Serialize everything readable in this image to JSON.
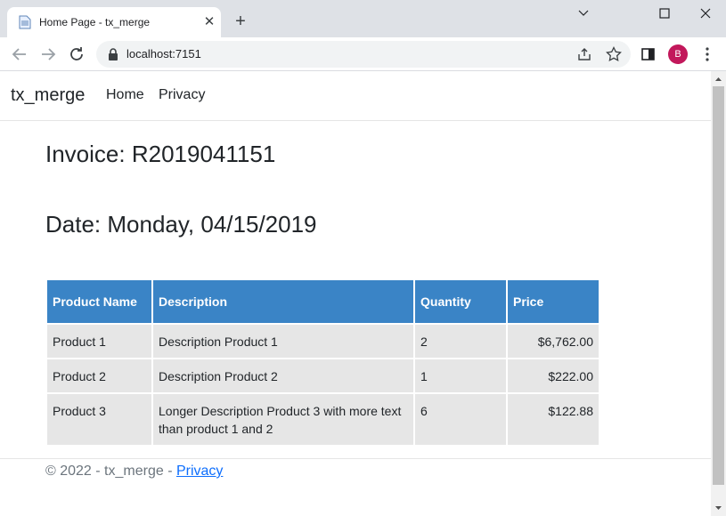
{
  "browser": {
    "tab_title": "Home Page - tx_merge",
    "url": "localhost:7151",
    "profile_initial": "B",
    "icons": [
      "page-favicon",
      "close-icon",
      "plus-icon",
      "minimize-icon",
      "maximize-icon",
      "close-window-icon",
      "back-arrow-icon",
      "forward-arrow-icon",
      "reload-icon",
      "lock-icon",
      "share-icon",
      "star-icon",
      "side-panel-icon",
      "kebab-menu-icon"
    ]
  },
  "site": {
    "brand": "tx_merge",
    "nav": {
      "home": "Home",
      "privacy": "Privacy"
    }
  },
  "invoice": {
    "title": "Invoice: R2019041151",
    "date": "Date: Monday, 04/15/2019"
  },
  "table": {
    "headers": [
      "Product Name",
      "Description",
      "Quantity",
      "Price"
    ],
    "header_color": "#3a84c6",
    "rows": [
      {
        "name": "Product 1",
        "description": "Description Product 1",
        "quantity": "2",
        "price": "$6,762.00"
      },
      {
        "name": "Product 2",
        "description": "Description Product 2",
        "quantity": "1",
        "price": "$222.00"
      },
      {
        "name": "Product 3",
        "description": "Longer Description Product 3 with more text than product 1 and 2",
        "quantity": "6",
        "price": "$122.88"
      }
    ]
  },
  "footer": {
    "text": "© 2022 - tx_merge - ",
    "link": "Privacy"
  }
}
